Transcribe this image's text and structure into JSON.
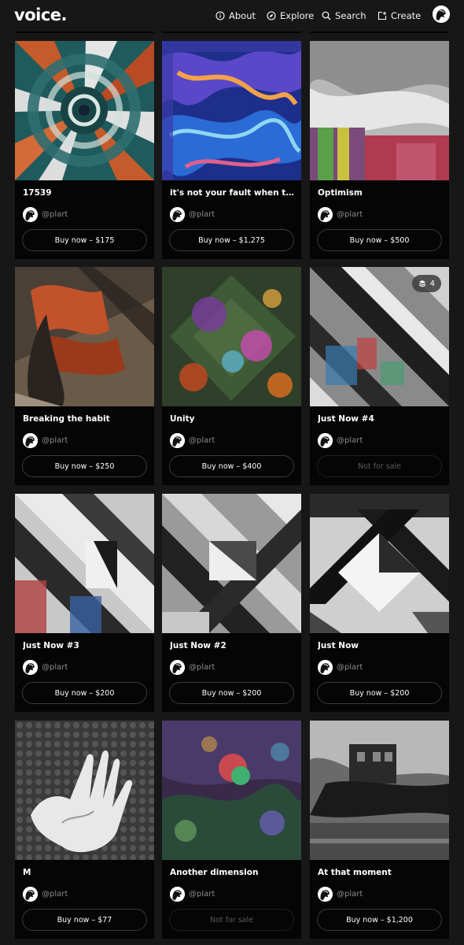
{
  "header": {
    "logo": "voice.",
    "nav": [
      {
        "label": "About",
        "icon": "info-icon"
      },
      {
        "label": "Explore",
        "icon": "compass-icon"
      },
      {
        "label": "Search",
        "icon": "search-icon"
      },
      {
        "label": "Create",
        "icon": "create-icon"
      }
    ]
  },
  "cards": [
    {
      "title": "17539",
      "owner": "@plart",
      "button": "Buy now – $175",
      "for_sale": true
    },
    {
      "title": "it's not your fault when the...",
      "owner": "@plart",
      "button": "Buy now – $1,275",
      "for_sale": true
    },
    {
      "title": "Optimism",
      "owner": "@plart",
      "button": "Buy now – $500",
      "for_sale": true
    },
    {
      "title": "Breaking the habit",
      "owner": "@plart",
      "button": "Buy now – $250",
      "for_sale": true
    },
    {
      "title": "Unity",
      "owner": "@plart",
      "button": "Buy now – $400",
      "for_sale": true
    },
    {
      "title": "Just Now #4",
      "owner": "@plart",
      "button": "Not for sale",
      "for_sale": false,
      "edition_badge": "4"
    },
    {
      "title": "Just Now #3",
      "owner": "@plart",
      "button": "Buy now – $200",
      "for_sale": true
    },
    {
      "title": "Just Now #2",
      "owner": "@plart",
      "button": "Buy now – $200",
      "for_sale": true
    },
    {
      "title": "Just Now",
      "owner": "@plart",
      "button": "Buy now – $200",
      "for_sale": true
    },
    {
      "title": "M",
      "owner": "@plart",
      "button": "Buy now – $77",
      "for_sale": true
    },
    {
      "title": "Another dimension",
      "owner": "@plart",
      "button": "Not for sale",
      "for_sale": false
    },
    {
      "title": "At that moment",
      "owner": "@plart",
      "button": "Buy now – $1,200",
      "for_sale": true
    }
  ]
}
